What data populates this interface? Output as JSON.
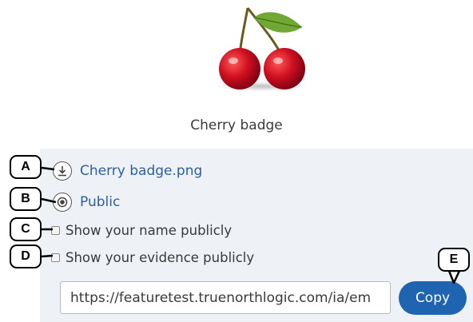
{
  "badge": {
    "title": "Cherry badge",
    "image_alt": "cherry"
  },
  "options": {
    "download_link": "Cherry badge.png",
    "visibility_label": "Public",
    "show_name_label": "Show your name publicly",
    "show_evidence_label": "Show your evidence publicly"
  },
  "share": {
    "url_value": "https://featuretest.truenorthlogic.com/ia/em",
    "copy_label": "Copy"
  },
  "callouts": {
    "a": "A",
    "b": "B",
    "c": "C",
    "d": "D",
    "e": "E"
  },
  "colors": {
    "accent": "#1e64b0",
    "link": "#2d5f9e",
    "panel_bg": "#eef2f6"
  }
}
